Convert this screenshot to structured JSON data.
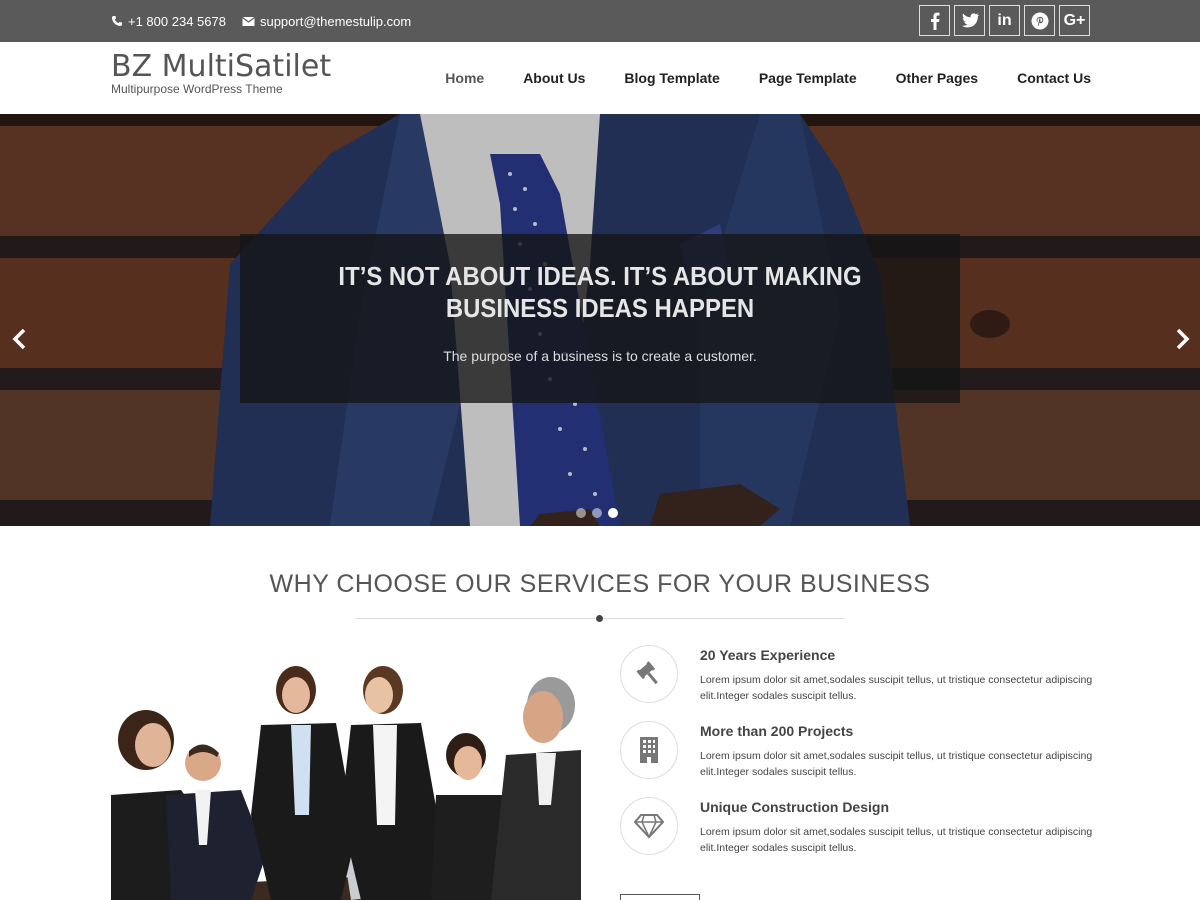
{
  "topbar": {
    "phone": "+1 800 234 5678",
    "email": "support@themestulip.com",
    "social": [
      {
        "icon": "facebook-icon",
        "glyph": "f"
      },
      {
        "icon": "twitter-icon",
        "glyph": ""
      },
      {
        "icon": "linkedin-icon",
        "glyph": "in"
      },
      {
        "icon": "pinterest-icon",
        "glyph": ""
      },
      {
        "icon": "google-plus-icon",
        "glyph": "G+"
      }
    ]
  },
  "header": {
    "site_name": "BZ MultiSatilet",
    "tagline": "Multipurpose WordPress Theme",
    "nav": [
      "Home",
      "About Us",
      "Blog Template",
      "Page Template",
      "Other Pages",
      "Contact Us"
    ]
  },
  "hero": {
    "title": "IT’S NOT ABOUT IDEAS. IT’S ABOUT MAKING BUSINESS IDEAS HAPPEN",
    "subtitle": "The purpose of a business is to create a customer.",
    "slides": 3,
    "active_slide": 3
  },
  "section": {
    "title": "WHY CHOOSE OUR SERVICES FOR YOUR BUSINESS",
    "features": [
      {
        "icon": "gavel-icon",
        "title": "20 Years Experience",
        "text": "Lorem ipsum dolor sit amet,sodales suscipit tellus, ut tristique consectetur adipiscing elit.Integer sodales suscipit tellus."
      },
      {
        "icon": "building-icon",
        "title": "More than 200 Projects",
        "text": "Lorem ipsum dolor sit amet,sodales suscipit tellus, ut tristique consectetur adipiscing elit.Integer sodales suscipit tellus."
      },
      {
        "icon": "diamond-icon",
        "title": "Unique Construction Design",
        "text": "Lorem ipsum dolor sit amet,sodales suscipit tellus, ut tristique consectetur adipiscing elit.Integer sodales suscipit tellus."
      }
    ]
  },
  "colors": {
    "topbar": "#5a5a5a",
    "caption_bg": "#141414",
    "text": "#444444"
  }
}
